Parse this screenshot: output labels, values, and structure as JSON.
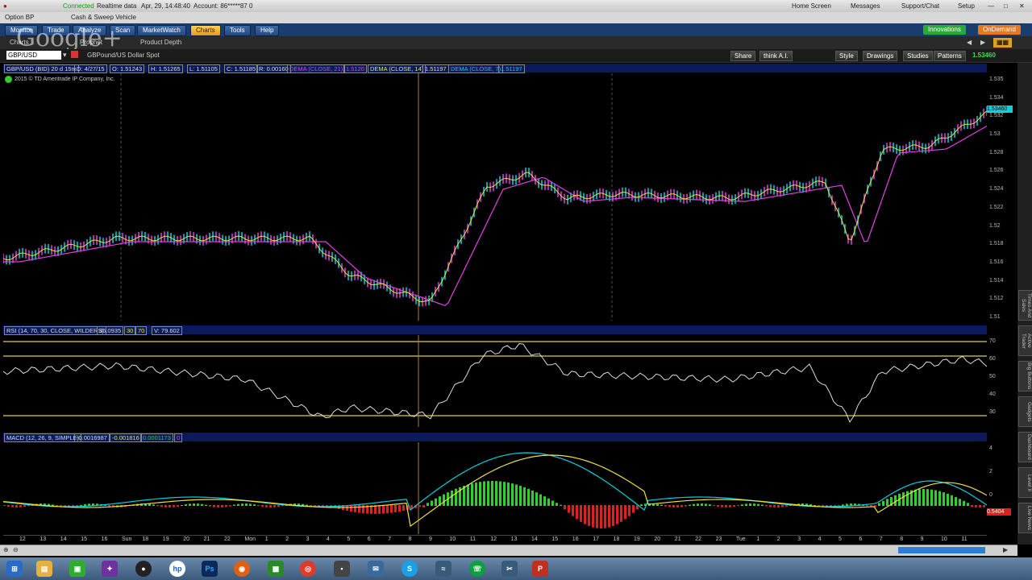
{
  "status_bar": {
    "conn_status": "Connected",
    "data_mode": "Realtime data",
    "datetime": "Apr, 29, 14:48:40",
    "account": "Account: 86*****87 0",
    "home_screen": "Home Screen",
    "messages": "Messages",
    "support_chat": "Support/Chat",
    "setup": "Setup"
  },
  "account_bar": {
    "option_bp": "Option BP",
    "cash_sweep": "Cash & Sweep Vehicle"
  },
  "main_tabs": [
    "Monitor",
    "Trade",
    "Analyze",
    "Scan",
    "MarketWatch",
    "Charts",
    "Tools",
    "Help"
  ],
  "active_tab": "Charts",
  "right_tabs": {
    "innovation": "Innovations",
    "ondemand": "OnDemand"
  },
  "sub_tabs": [
    "Charts",
    "Prophet",
    "Product Depth"
  ],
  "watermark": "Google+",
  "symbol_bar": {
    "symbol": "GBP/USD",
    "description": "GBPound/US Dollar Spot",
    "buttons": [
      "Share",
      "think A.I.",
      "Style",
      "Drawings",
      "Studies",
      "Patterns"
    ],
    "last_price": "1.53460"
  },
  "price_header": {
    "symbol_period": "GBP/USD (BID) 20 d 15m",
    "date": "D: 4/27/15",
    "open": "O: 1.51243",
    "high": "H: 1.51265",
    "low": "L: 1.51105",
    "close": "C: 1.51185",
    "range": "R: 0.00160",
    "dema21": "DEMA (CLOSE, 21)",
    "dema21_val": "1.5120",
    "dema14": "DEMA (CLOSE, 14)",
    "dema14_val": "1.51197",
    "dema7": "DEMA (CLOSE, 7)",
    "dema7_val": "1.51197",
    "copyright": "2015 © TD Ameritrade IP Company, Inc."
  },
  "price_axis": [
    "1.535",
    "1.534",
    "1.532",
    "1.53",
    "1.528",
    "1.526",
    "1.524",
    "1.522",
    "1.52",
    "1.518",
    "1.516",
    "1.514",
    "1.512",
    "1.51"
  ],
  "price_tag": "1.53460",
  "rsi_header": {
    "label": "RSI (14, 70, 30, CLOSE, WILDERS)",
    "value": "36.0935",
    "ob": "30",
    "os": "70",
    "v": "V: 79.602"
  },
  "rsi_axis": [
    "70",
    "60",
    "50",
    "40",
    "30"
  ],
  "macd_header": {
    "label": "MACD (12, 26, 9, SIMPLE)",
    "v1": "-0.0016987",
    "v2": "-0.001816",
    "v3": "0.0001173",
    "v4": "0"
  },
  "macd_axis": [
    "4",
    "2",
    "0"
  ],
  "macd_tag": "0.5404",
  "x_axis": [
    "12",
    "13",
    "14",
    "15",
    "16",
    "Sun",
    "18",
    "19",
    "20",
    "21",
    "22",
    "Mon",
    "1",
    "2",
    "3",
    "4",
    "5",
    "6",
    "7",
    "8",
    "9",
    "10",
    "11",
    "12",
    "13",
    "14",
    "15",
    "16",
    "17",
    "18",
    "19",
    "20",
    "21",
    "22",
    "23",
    "Tue",
    "1",
    "2",
    "3",
    "4",
    "5",
    "6",
    "7",
    "8",
    "9",
    "10",
    "11"
  ],
  "sidebar_labels": [
    "Live News",
    "Level II",
    "Dashboard",
    "Gadgets",
    "Big Buttons",
    "Active Trader",
    "Times And Sales"
  ],
  "colors": {
    "dema21": "#e040e0",
    "dema14": "#f0e040",
    "dema7": "#00d0e0",
    "rsi_line": "#dddddd",
    "rsi_bound": "#e0d030",
    "macd_up": "#30d030",
    "macd_down": "#e02020"
  }
}
